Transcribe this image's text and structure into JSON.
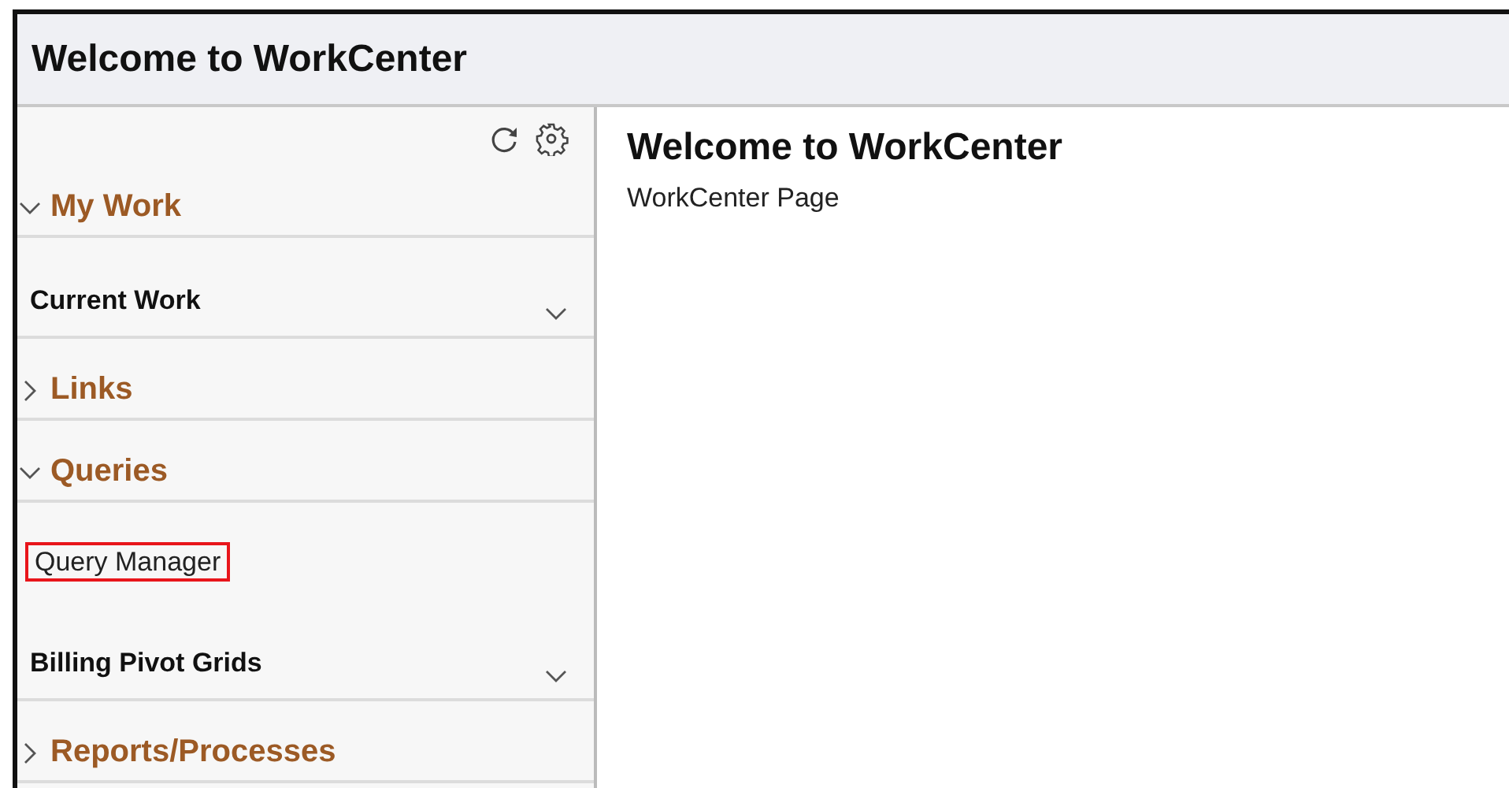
{
  "header": {
    "title": "Welcome to WorkCenter"
  },
  "sidebar": {
    "items": [
      {
        "kind": "section",
        "label": "My Work",
        "expanded": true
      },
      {
        "kind": "group",
        "label": "Current Work"
      },
      {
        "kind": "section",
        "label": "Links",
        "expanded": false
      },
      {
        "kind": "section",
        "label": "Queries",
        "expanded": true
      },
      {
        "kind": "link",
        "label": "Query Manager",
        "highlighted": true
      },
      {
        "kind": "group",
        "label": "Billing Pivot Grids"
      },
      {
        "kind": "section",
        "label": "Reports/Processes",
        "expanded": false
      }
    ]
  },
  "content": {
    "title": "Welcome to WorkCenter",
    "subtitle": "WorkCenter Page"
  }
}
